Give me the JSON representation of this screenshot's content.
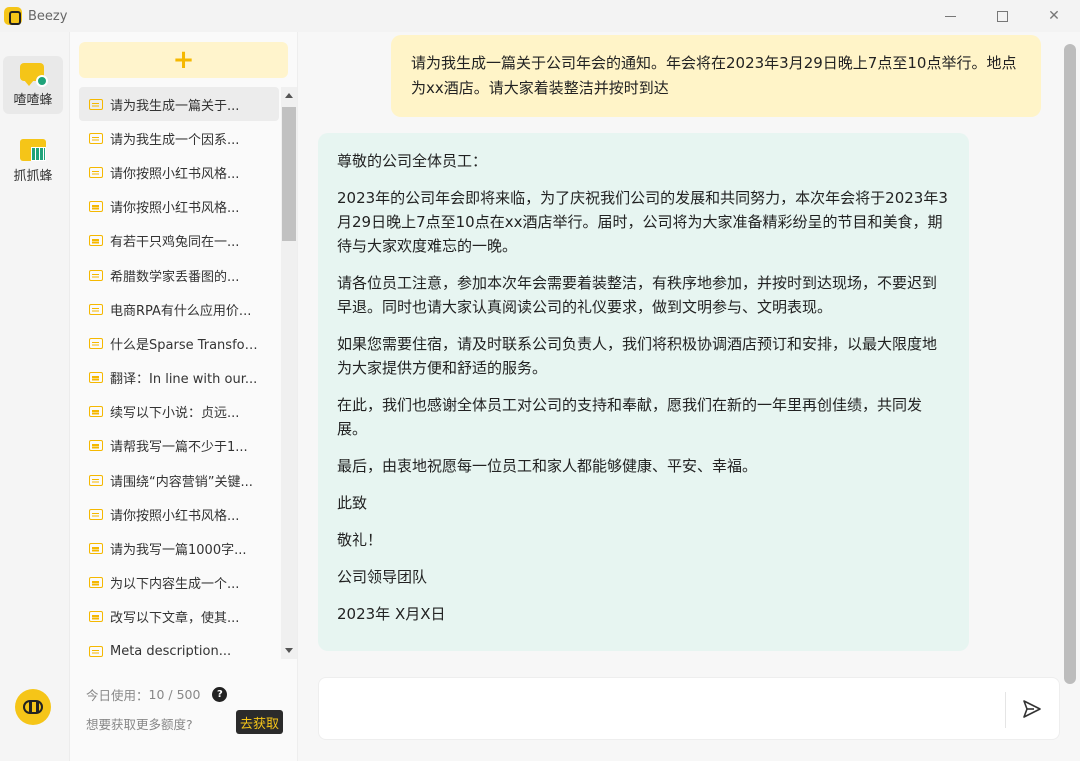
{
  "window": {
    "title": "Beezy"
  },
  "rail": {
    "items": [
      {
        "label": "喳喳蜂",
        "icon": "chat-bee-icon",
        "active": true
      },
      {
        "label": "抓抓蜂",
        "icon": "grab-bee-icon",
        "active": false
      }
    ]
  },
  "sidebar": {
    "new_chat_label": "+",
    "history": [
      "请为我生成一篇关于...",
      "请为我生成一个因系...",
      "请你按照小红书风格...",
      "请你按照小红书风格...",
      "有若干只鸡兔同在一...",
      "希腊数学家丢番图的...",
      "电商RPA有什么应用价...",
      "什么是Sparse Transfor...",
      "翻译：In line with our...",
      "续写以下小说：贞远...",
      "请帮我写一篇不少于1...",
      "请围绕“内容营销”关键...",
      "请你按照小红书风格...",
      "请为我写一篇1000字...",
      "为以下内容生成一个...",
      "改写以下文章，使其...",
      "Meta description..."
    ],
    "usage_label": "今日使用：",
    "usage_value": "10 / 500",
    "quota_question": "想要获取更多额度?",
    "get_more_label": "去获取"
  },
  "chat": {
    "user_message": "请为我生成一篇关于公司年会的通知。年会将在2023年3月29日晚上7点至10点举行。地点为xx酒店。请大家着装整洁并按时到达",
    "bot_paragraphs": [
      "尊敬的公司全体员工：",
      "2023年的公司年会即将来临，为了庆祝我们公司的发展和共同努力，本次年会将于2023年3月29日晚上7点至10点在xx酒店举行。届时，公司将为大家准备精彩纷呈的节目和美食，期待与大家欢度难忘的一晚。",
      "请各位员工注意，参加本次年会需要着装整洁，有秩序地参加，并按时到达现场，不要迟到早退。同时也请大家认真阅读公司的礼仪要求，做到文明参与、文明表现。",
      "如果您需要住宿，请及时联系公司负责人，我们将积极协调酒店预订和安排，以最大限度地为大家提供方便和舒适的服务。",
      "在此，我们也感谢全体员工对公司的支持和奉献，愿我们在新的一年里再创佳绩，共同发展。",
      "最后，由衷地祝愿每一位员工和家人都能够健康、平安、幸福。",
      "此致",
      "敬礼！",
      "公司领导团队",
      "2023年 X月X日"
    ],
    "input_value": ""
  },
  "colors": {
    "brand_yellow": "#f5c518",
    "user_bubble": "#fff4c8",
    "bot_bubble": "#e7f5f1"
  }
}
